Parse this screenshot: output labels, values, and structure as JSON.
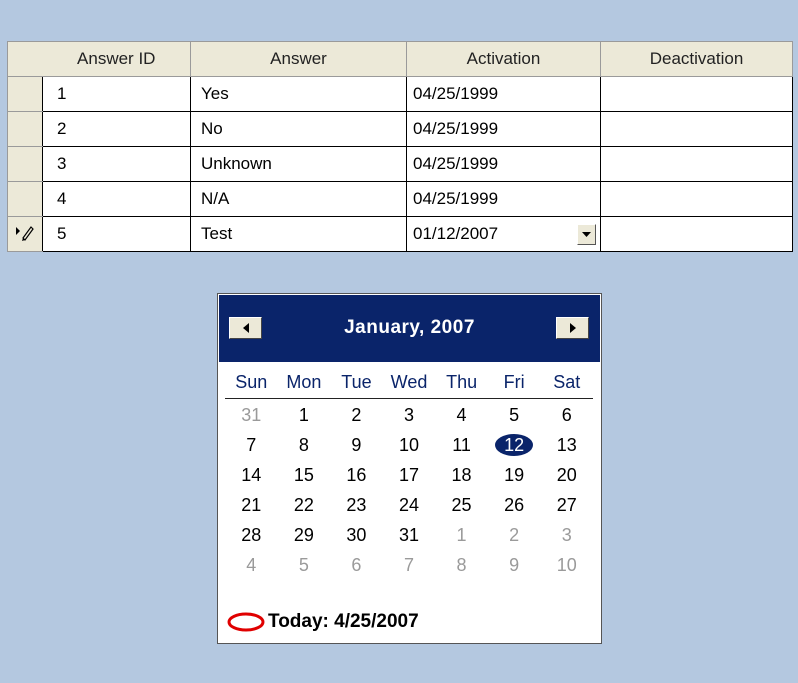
{
  "grid": {
    "columns": [
      "Answer ID",
      "Answer",
      "Activation",
      "Deactivation"
    ],
    "rows": [
      {
        "id": "1",
        "answer": "Yes",
        "activation": "04/25/1999",
        "deactivation": ""
      },
      {
        "id": "2",
        "answer": "No",
        "activation": "04/25/1999",
        "deactivation": ""
      },
      {
        "id": "3",
        "answer": "Unknown",
        "activation": "04/25/1999",
        "deactivation": ""
      },
      {
        "id": "4",
        "answer": "N/A",
        "activation": "04/25/1999",
        "deactivation": ""
      },
      {
        "id": "5",
        "answer": "Test",
        "activation": "01/12/2007",
        "deactivation": ""
      }
    ],
    "editing_row_indicator": "pencil-icon"
  },
  "calendar": {
    "month_title": "January, 2007",
    "day_names": [
      "Sun",
      "Mon",
      "Tue",
      "Wed",
      "Thu",
      "Fri",
      "Sat"
    ],
    "weeks": [
      [
        {
          "d": "31",
          "other": true
        },
        {
          "d": "1"
        },
        {
          "d": "2"
        },
        {
          "d": "3"
        },
        {
          "d": "4"
        },
        {
          "d": "5"
        },
        {
          "d": "6"
        }
      ],
      [
        {
          "d": "7"
        },
        {
          "d": "8"
        },
        {
          "d": "9"
        },
        {
          "d": "10"
        },
        {
          "d": "11"
        },
        {
          "d": "12",
          "selected": true
        },
        {
          "d": "13"
        }
      ],
      [
        {
          "d": "14"
        },
        {
          "d": "15"
        },
        {
          "d": "16"
        },
        {
          "d": "17"
        },
        {
          "d": "18"
        },
        {
          "d": "19"
        },
        {
          "d": "20"
        }
      ],
      [
        {
          "d": "21"
        },
        {
          "d": "22"
        },
        {
          "d": "23"
        },
        {
          "d": "24"
        },
        {
          "d": "25"
        },
        {
          "d": "26"
        },
        {
          "d": "27"
        }
      ],
      [
        {
          "d": "28"
        },
        {
          "d": "29"
        },
        {
          "d": "30"
        },
        {
          "d": "31"
        },
        {
          "d": "1",
          "other": true
        },
        {
          "d": "2",
          "other": true
        },
        {
          "d": "3",
          "other": true
        }
      ],
      [
        {
          "d": "4",
          "other": true
        },
        {
          "d": "5",
          "other": true
        },
        {
          "d": "6",
          "other": true
        },
        {
          "d": "7",
          "other": true
        },
        {
          "d": "8",
          "other": true
        },
        {
          "d": "9",
          "other": true
        },
        {
          "d": "10",
          "other": true
        }
      ]
    ],
    "today_label": "Today: 4/25/2007"
  },
  "colors": {
    "background": "#b4c8e0",
    "header_bar": "#0a246a",
    "today_ring": "#e00000"
  }
}
